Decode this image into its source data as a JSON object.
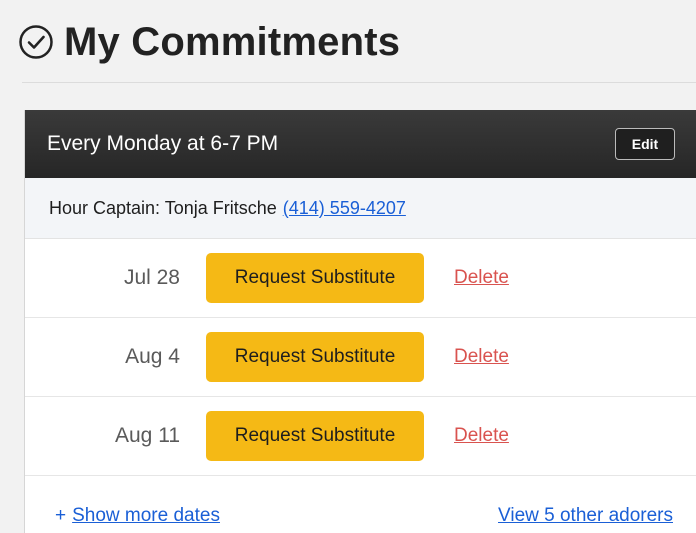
{
  "page": {
    "title": "My Commitments",
    "title_icon": "check-circle-icon"
  },
  "commitment": {
    "schedule": "Every Monday at 6-7 PM",
    "edit_label": "Edit",
    "captain_label": "Hour Captain: Tonja Fritsche",
    "captain_phone": "(414) 559-4207",
    "dates": [
      {
        "date": "Jul 28",
        "substitute_label": "Request Substitute",
        "delete_label": "Delete"
      },
      {
        "date": "Aug 4",
        "substitute_label": "Request Substitute",
        "delete_label": "Delete"
      },
      {
        "date": "Aug 11",
        "substitute_label": "Request Substitute",
        "delete_label": "Delete"
      }
    ],
    "show_more_prefix": "+",
    "show_more_label": "Show more dates",
    "other_adorers_label": "View 5 other adorers"
  },
  "colors": {
    "header_bg": "#2b2b2b",
    "substitute_button": "#f5b915",
    "delete_link": "#d9534f",
    "link": "#1a5fd6"
  }
}
